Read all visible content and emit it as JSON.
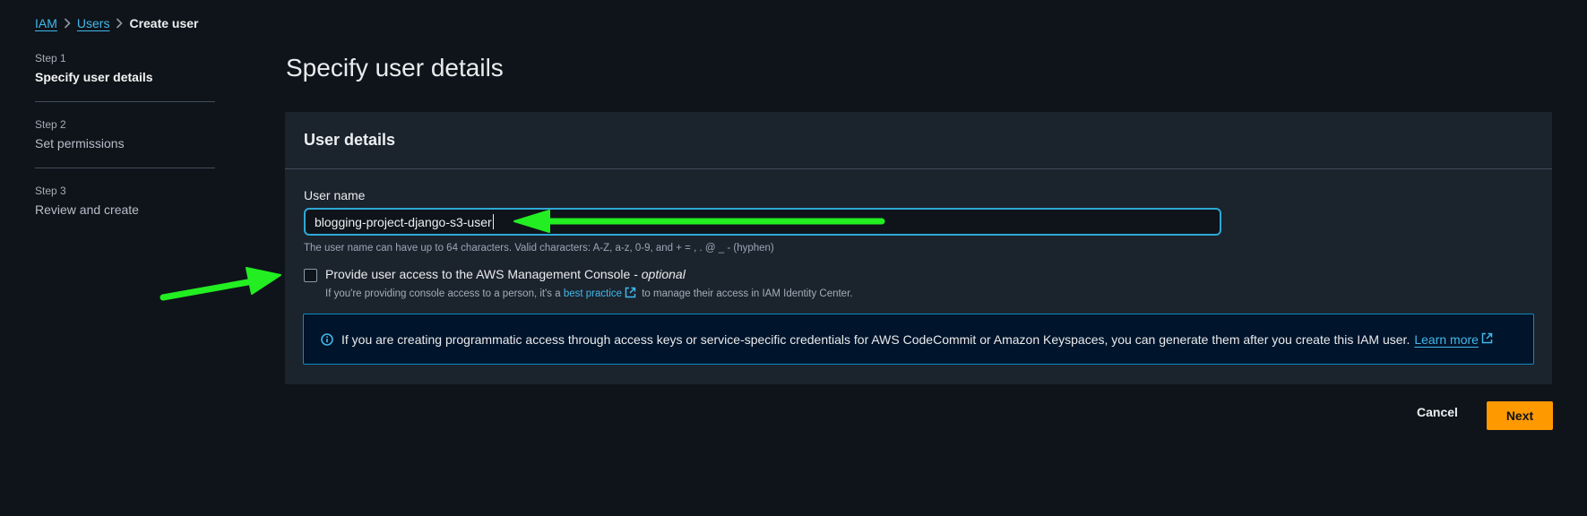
{
  "breadcrumb": {
    "items": [
      "IAM",
      "Users"
    ],
    "current": "Create user"
  },
  "steps": [
    {
      "num": "Step 1",
      "title": "Specify user details"
    },
    {
      "num": "Step 2",
      "title": "Set permissions"
    },
    {
      "num": "Step 3",
      "title": "Review and create"
    }
  ],
  "page_title": "Specify user details",
  "card": {
    "title": "User details",
    "field_label": "User name",
    "input_value": "blogging-project-django-s3-user",
    "hint": "The user name can have up to 64 characters. Valid characters: A-Z, a-z, 0-9, and + = , . @ _ - (hyphen)",
    "checkbox_label": "Provide user access to the AWS Management Console - ",
    "checkbox_optional": "optional",
    "checkbox_desc_before": "If you're providing console access to a person, it's a ",
    "checkbox_desc_link": "best practice",
    "checkbox_desc_after": " to manage their access in IAM Identity Center.",
    "info_text": "If you are creating programmatic access through access keys or service-specific credentials for AWS CodeCommit or Amazon Keyspaces, you can generate them after you create this IAM user.",
    "info_link": "Learn more"
  },
  "buttons": {
    "cancel": "Cancel",
    "next": "Next"
  },
  "colors": {
    "accent_link": "#42b8ea",
    "primary_button": "#ff9900",
    "annotation_arrow": "#22ee22",
    "background": "#0f141a"
  }
}
